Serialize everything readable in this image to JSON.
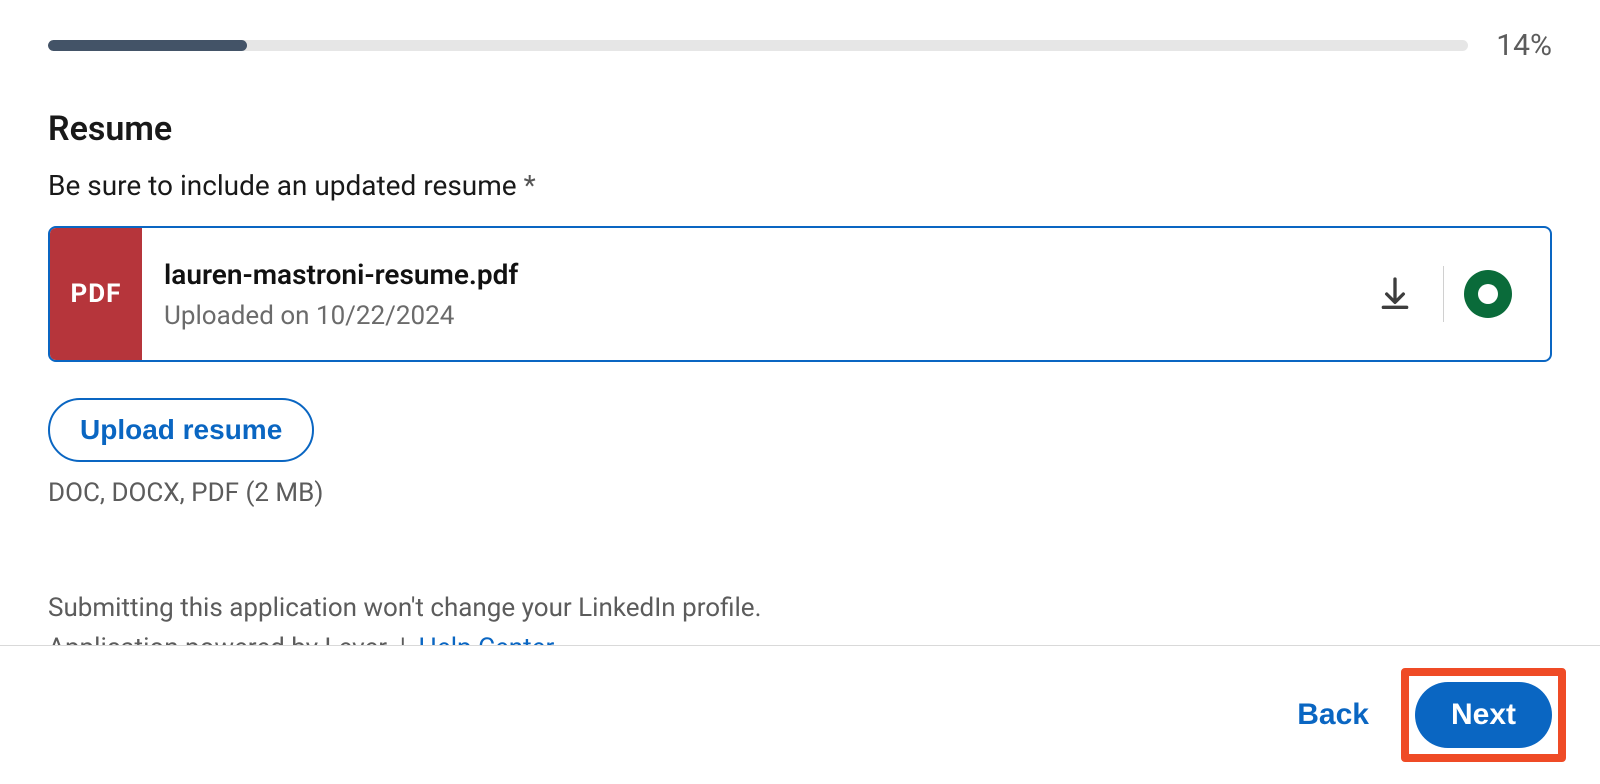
{
  "progress": {
    "percent": 14,
    "label": "14%"
  },
  "section": {
    "title": "Resume",
    "subtitle": "Be sure to include an updated resume",
    "required_marker": "*"
  },
  "file": {
    "badge": "PDF",
    "name": "lauren-mastroni-resume.pdf",
    "uploaded_label": "Uploaded on 10/22/2024"
  },
  "upload": {
    "button_label": "Upload resume",
    "hint": "DOC, DOCX, PDF (2 MB)"
  },
  "footer_text": {
    "line1": "Submitting this application won't change your LinkedIn profile.",
    "line2_prefix": "Application powered by Lever",
    "separator": "|",
    "help_link_label": "Help Center"
  },
  "nav": {
    "back_label": "Back",
    "next_label": "Next"
  }
}
